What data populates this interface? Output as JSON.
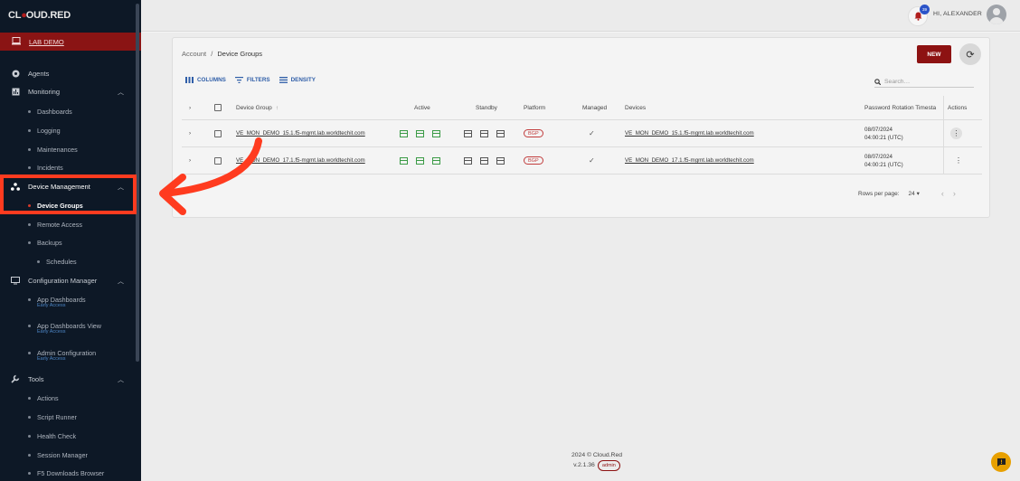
{
  "brand": {
    "logo_a": "CL",
    "logo_b": "OUD.RED"
  },
  "sidebar": {
    "lab": "LAB DEMO",
    "items": [
      {
        "label": "Agents",
        "icon": "agents-icon"
      },
      {
        "label": "Monitoring",
        "icon": "monitoring-icon"
      },
      {
        "label": "Dashboards"
      },
      {
        "label": "Logging"
      },
      {
        "label": "Maintenances"
      },
      {
        "label": "Incidents"
      },
      {
        "label": "Device Management",
        "icon": "device-management-icon"
      },
      {
        "label": "Device Groups"
      },
      {
        "label": "Remote Access"
      },
      {
        "label": "Backups"
      },
      {
        "label": "Schedules"
      },
      {
        "label": "Configuration Manager",
        "icon": "monitor-icon"
      },
      {
        "label": "App Dashboards",
        "badge": "Early Access"
      },
      {
        "label": "App Dashboards View",
        "badge": "Early Access"
      },
      {
        "label": "Admin Configuration",
        "badge": "Early Access"
      },
      {
        "label": "Tools",
        "icon": "wrench-icon"
      },
      {
        "label": "Actions"
      },
      {
        "label": "Script Runner"
      },
      {
        "label": "Health Check"
      },
      {
        "label": "Session Manager"
      },
      {
        "label": "F5 Downloads Browser"
      }
    ]
  },
  "header": {
    "greeting": "HI, ALEXANDER",
    "notifications": "39"
  },
  "breadcrumb": {
    "root": "Account",
    "sep": "/",
    "current": "Device Groups"
  },
  "buttons": {
    "new": "NEW"
  },
  "toolbar": {
    "columns": "COLUMNS",
    "filters": "FILTERS",
    "density": "DENSITY"
  },
  "search": {
    "placeholder": "Search…"
  },
  "table": {
    "headers": {
      "device_group": "Device Group",
      "active": "Active",
      "standby": "Standby",
      "platform": "Platform",
      "managed": "Managed",
      "devices": "Devices",
      "password_rotation": "Password Rotation Timesta",
      "actions": "Actions"
    },
    "rows": [
      {
        "device_group": "VE_MON_DEMO_15.1.f5-mgmt.lab.worldtechit.com",
        "platform": "BGP",
        "devices": "VE_MON_DEMO_15.1.f5-mgmt.lab.worldtechit.com",
        "date": "08/07/2024",
        "time": "04:00:21 (UTC)"
      },
      {
        "device_group": "VE_MON_DEMO_17.1.f5-mgmt.lab.worldtechit.com",
        "platform": "BGP",
        "devices": "VE_MON_DEMO_17.1.f5-mgmt.lab.worldtechit.com",
        "date": "08/07/2024",
        "time": "04:00:21 (UTC)"
      }
    ]
  },
  "pagination": {
    "label": "Rows per page:",
    "value": "24"
  },
  "footer": {
    "copyright": "2024 © Cloud.Red",
    "version": "v.2.1.36",
    "role": "admin"
  },
  "colors": {
    "brand_red": "#8d1212",
    "sidebar_bg": "#0d1826",
    "highlight": "#ff3b1f",
    "link_blue": "#2f5ea8"
  }
}
